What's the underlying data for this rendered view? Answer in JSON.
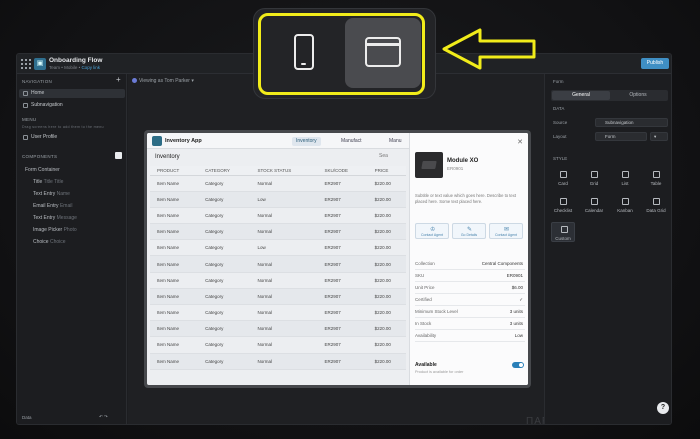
{
  "app": {
    "title": "Onboarding Flow",
    "subtitle_prefix": "Team • Mobile •",
    "subtitle_link": "Copy link",
    "publish_label": "Publish"
  },
  "sidebar": {
    "navigation_header": "NAVIGATION",
    "add_label": "+",
    "nav_items": [
      {
        "label": "Home",
        "selected": true
      },
      {
        "label": "Subnavigation",
        "selected": false
      }
    ],
    "menu_header": "MENU",
    "menu_hint": "Drag screens here to add them to the menu",
    "menu_items": [
      {
        "label": "User Profile"
      }
    ],
    "components_header": "COMPONENTS",
    "components": [
      {
        "label": "Form Container",
        "hint": ""
      },
      {
        "label": "Title",
        "hint": "Title Title"
      },
      {
        "label": "Text Entry",
        "hint": "Name"
      },
      {
        "label": "Email Entry",
        "hint": "Email"
      },
      {
        "label": "Text Entry",
        "hint": "Message"
      },
      {
        "label": "Image Picker",
        "hint": "Photo"
      },
      {
        "label": "Choice",
        "hint": "Choice"
      }
    ],
    "bottom_left": "Data",
    "bottom_right": "↶ ↷"
  },
  "canvas": {
    "viewing_label": "Viewing as Tom Parker ▾",
    "inventory_app": {
      "app_name": "Inventory App",
      "tabs": [
        {
          "label": "Inventory",
          "selected": true
        },
        {
          "label": "Manufact",
          "selected": false
        },
        {
          "label": "Manu",
          "selected": false
        }
      ],
      "heading": "Inventory",
      "search_label": "Sea",
      "columns": [
        "PRODUCT",
        "CATEGORY",
        "STOCK STATUS",
        "SKU/CODE",
        "PRICE"
      ],
      "rows": [
        [
          "Item Name",
          "Category",
          "Normal",
          "ER2907",
          "$220.00"
        ],
        [
          "Item Name",
          "Category",
          "Low",
          "ER2907",
          "$220.00"
        ],
        [
          "Item Name",
          "Category",
          "Normal",
          "ER2907",
          "$220.00"
        ],
        [
          "Item Name",
          "Category",
          "Normal",
          "ER2907",
          "$220.00"
        ],
        [
          "Item Name",
          "Category",
          "Low",
          "ER2907",
          "$220.00"
        ],
        [
          "Item Name",
          "Category",
          "Normal",
          "ER2907",
          "$220.00"
        ],
        [
          "Item Name",
          "Category",
          "Normal",
          "ER2907",
          "$220.00"
        ],
        [
          "Item Name",
          "Category",
          "Normal",
          "ER2907",
          "$220.00"
        ],
        [
          "Item Name",
          "Category",
          "Normal",
          "ER2907",
          "$220.00"
        ],
        [
          "Item Name",
          "Category",
          "Normal",
          "ER2907",
          "$220.00"
        ],
        [
          "Item Name",
          "Category",
          "Normal",
          "ER2907",
          "$220.00"
        ],
        [
          "Item Name",
          "Category",
          "Normal",
          "ER2907",
          "$220.00"
        ]
      ],
      "detail": {
        "product_name": "Module XO",
        "product_code": "ER0901",
        "description": "Subtitle or text value which goes here. Describe to text placed here. Some text placed here.",
        "actions": [
          "Contact Agent",
          "Go Details",
          "Contact Agent"
        ],
        "fields": [
          {
            "key": "Collection",
            "value": "Central Components"
          },
          {
            "key": "SKU",
            "value": "ER0901"
          },
          {
            "key": "Unit Price",
            "value": "$6.00"
          },
          {
            "key": "Certified",
            "value": "✓"
          },
          {
            "key": "Minimum Stock Level",
            "value": "3 units"
          },
          {
            "key": "In Stock",
            "value": "3 units"
          },
          {
            "key": "Availability",
            "value": "Low"
          }
        ],
        "available_label": "Available",
        "available_sub": "Product is available for order",
        "available_on": true
      }
    },
    "watermark": "ПАРТНЕРКИН"
  },
  "right_panel": {
    "section_label": "Form",
    "tabs": [
      {
        "label": "General",
        "selected": true
      },
      {
        "label": "Options",
        "selected": false
      }
    ],
    "data_label": "DATA",
    "source_label": "Source",
    "source_value": "Subnavigation",
    "layout_label": "Layout",
    "layout_value": "Form",
    "style_label": "STYLE",
    "styles": [
      {
        "label": "Card",
        "selected": false
      },
      {
        "label": "Grid",
        "selected": false
      },
      {
        "label": "List",
        "selected": false
      },
      {
        "label": "Table",
        "selected": false
      },
      {
        "label": "Checklist",
        "selected": false
      },
      {
        "label": "Calendar",
        "selected": false
      },
      {
        "label": "Kanban",
        "selected": false
      },
      {
        "label": "Data Grid",
        "selected": false
      },
      {
        "label": "Custom",
        "selected": true
      }
    ],
    "help_label": "?"
  },
  "device_switcher": {
    "options": [
      {
        "icon": "phone-icon",
        "selected": false
      },
      {
        "icon": "desktop-icon",
        "selected": true
      }
    ],
    "highlight_color": "#f1ec1a",
    "arrow_color": "#f1ec1a"
  }
}
